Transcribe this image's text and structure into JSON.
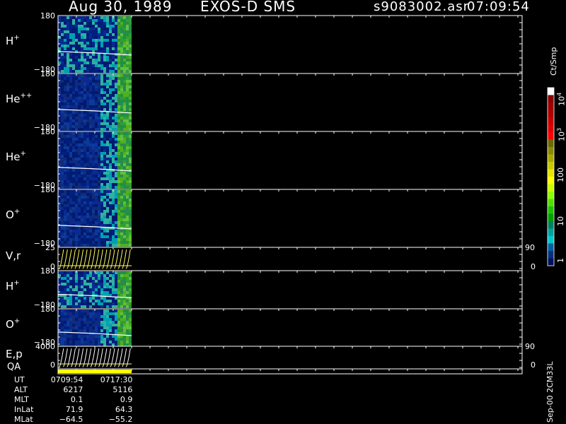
{
  "header": {
    "date": "Aug 30, 1989",
    "instrument": "EXOS-D SMS",
    "filename": "s9083002.asr",
    "time": "07:09:54"
  },
  "chart_data": {
    "type": "heatmap",
    "panels": [
      {
        "label": "H",
        "sup": "+",
        "y_top": "180",
        "y_bottom": "−180",
        "kind": "spectrogram"
      },
      {
        "label": "He",
        "sup": "++",
        "y_top": "180",
        "y_bottom": "−180",
        "kind": "spectrogram"
      },
      {
        "label": "He",
        "sup": "+",
        "y_top": "180",
        "y_bottom": "−180",
        "kind": "spectrogram"
      },
      {
        "label": "O",
        "sup": "+",
        "y_top": "180",
        "y_bottom": "−180",
        "kind": "spectrogram"
      },
      {
        "label": "V,r",
        "sup": "",
        "y_top": "25",
        "y_bottom": "0",
        "right_top": "90",
        "right_bottom": "0",
        "kind": "line"
      },
      {
        "label": "H",
        "sup": "+",
        "y_top": "180",
        "y_bottom": "−180",
        "kind": "spectrogram"
      },
      {
        "label": "O",
        "sup": "+",
        "y_top": "180",
        "y_bottom": "−180",
        "kind": "spectrogram"
      },
      {
        "label": "E,p",
        "sup": "",
        "y_top": "4000",
        "y_bottom": "0",
        "right_top": "90",
        "right_bottom": "0",
        "kind": "line"
      }
    ],
    "qa_label": "QA",
    "colorbar": {
      "unit": "Ct/Smp",
      "tick_labels": [
        {
          "base": "10",
          "exp": "4"
        },
        {
          "base": "10",
          "exp": "3"
        },
        {
          "base": "100",
          "exp": ""
        },
        {
          "base": "10",
          "exp": ""
        },
        {
          "base": "1",
          "exp": ""
        }
      ],
      "colors": [
        "#ffffff",
        "#8b0000",
        "#a00000",
        "#b00000",
        "#c80000",
        "#e00000",
        "#ff0000",
        "#6b6b00",
        "#8a8a00",
        "#a8a800",
        "#c8c800",
        "#e6e600",
        "#ffff00",
        "#c8ff00",
        "#8cff00",
        "#50e000",
        "#20c000",
        "#00a000",
        "#008060",
        "#00a0a0",
        "#00c8c8",
        "#0060a0",
        "#003080",
        "#001060"
      ]
    },
    "orbit_rows": [
      {
        "label": "UT",
        "values": [
          "0709:54",
          "0717:30"
        ]
      },
      {
        "label": "ALT",
        "values": [
          "6217",
          "5116"
        ]
      },
      {
        "label": "MLT",
        "values": [
          "0.1",
          "0.9"
        ]
      },
      {
        "label": "InLat",
        "values": [
          "71.9",
          "64.3"
        ]
      },
      {
        "label": "MLat",
        "values": [
          "−64.5",
          "−55.2"
        ]
      }
    ],
    "footer_id": "Sep-00 2CM33L"
  }
}
